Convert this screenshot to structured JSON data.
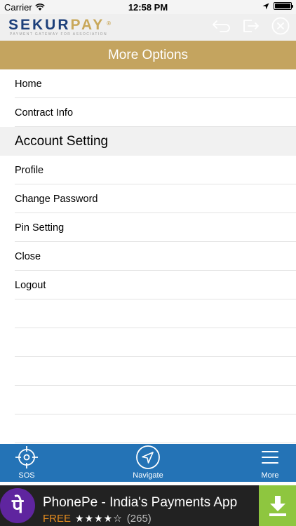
{
  "status_bar": {
    "carrier": "Carrier",
    "time": "12:58 PM",
    "battery_level": 1.0
  },
  "header": {
    "logo": {
      "wordmark_part1": "SEKUR",
      "wordmark_part2": "PAY",
      "registered": "®",
      "tagline": "PAYMENT GATEWAY FOR ASSOCIATION"
    },
    "icons": [
      "back-arrow-icon",
      "logout-icon",
      "close-circle-icon"
    ]
  },
  "title_bar": {
    "title": "More Options"
  },
  "menu": {
    "items_group1": [
      {
        "label": "Home"
      },
      {
        "label": "Contract Info"
      }
    ],
    "section_header": "Account Setting",
    "items_group2": [
      {
        "label": "Profile"
      },
      {
        "label": "Change Password"
      },
      {
        "label": "Pin Setting"
      },
      {
        "label": "Close"
      },
      {
        "label": "Logout"
      }
    ]
  },
  "tab_bar": {
    "tabs": [
      {
        "label": "SOS",
        "icon": "crosshair-icon"
      },
      {
        "label": "Navigate",
        "icon": "navigation-arrow-icon"
      },
      {
        "label": "More",
        "icon": "hamburger-menu-icon"
      }
    ]
  },
  "ad": {
    "logo_glyph": "पे",
    "title": "PhonePe - India's Payments App",
    "price": "FREE",
    "stars": "★★★★☆",
    "rating": 4,
    "review_count": "(265)"
  },
  "colors": {
    "brand_gold": "#c4a45f",
    "tab_bar_blue": "#2473b6",
    "logo_blue": "#1c3f7a",
    "ad_green": "#8ec63f",
    "phonepe_purple": "#5f259f"
  }
}
